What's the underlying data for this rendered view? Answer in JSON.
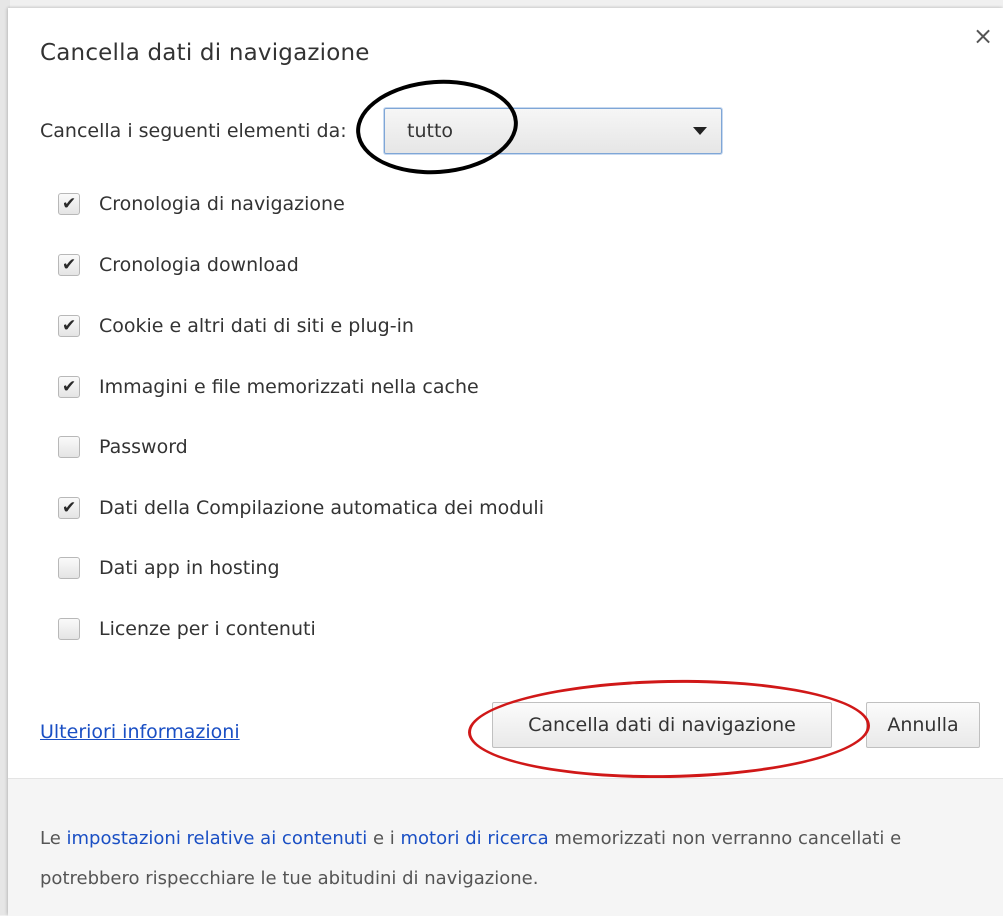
{
  "dialog": {
    "title": "Cancella dati di navigazione",
    "close_symbol": "×"
  },
  "range": {
    "label": "Cancella i seguenti elementi da:",
    "selected": "tutto"
  },
  "options": [
    {
      "label": "Cronologia di navigazione",
      "checked": true
    },
    {
      "label": "Cronologia download",
      "checked": true
    },
    {
      "label": "Cookie e altri dati di siti e plug-in",
      "checked": true
    },
    {
      "label": "Immagini e file memorizzati nella cache",
      "checked": true
    },
    {
      "label": "Password",
      "checked": false
    },
    {
      "label": "Dati della Compilazione automatica dei moduli",
      "checked": true
    },
    {
      "label": "Dati app in hosting",
      "checked": false
    },
    {
      "label": "Licenze per i contenuti",
      "checked": false
    }
  ],
  "actions": {
    "more_info": "Ulteriori informazioni",
    "clear_button": "Cancella dati di navigazione",
    "cancel_button": "Annulla"
  },
  "footer": {
    "part1": "Le ",
    "link1": "impostazioni relative ai contenuti",
    "part2": " e i ",
    "link2": "motori di ricerca",
    "part3": " memorizzati non verranno cancellati e potrebbero rispecchiare le tue abitudini di navigazione."
  },
  "colors": {
    "link": "#1a4fc4",
    "annotation_black": "#000000",
    "annotation_red": "#d01818"
  },
  "icons": {
    "close": "close-icon",
    "dropdown": "chevron-down-icon",
    "check": "checkmark-icon"
  }
}
